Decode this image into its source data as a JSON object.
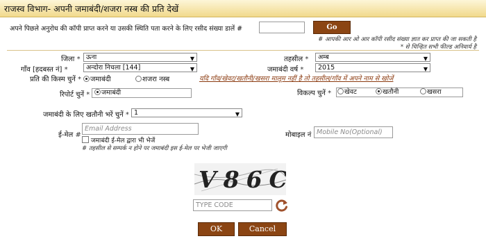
{
  "header": {
    "title": "राजस्व विभाग- अपनी जमाबंदी/शजरा नस्ब की प्रति देखें"
  },
  "receipt": {
    "label": "अपने पिछले अनुरोध की कॉपी प्राप्त करने या उसकी स्थिति पता करने के लिए रसीद संख्या डालें #",
    "value": "",
    "go_label": "Go",
    "note1": "# आपकी आर ओ आर कॉपी रसीद संख्या ज्ञात कर प्राप्त की जा सकती है",
    "note2": "* से चिन्हित सभी फील्ड अनिवार्य है"
  },
  "fields": {
    "district_label": "जिला",
    "district_value": "ऊना",
    "tehsil_label": "तहसील",
    "tehsil_value": "अम्ब",
    "village_label": "गाँव [हदबस्त नं]",
    "village_value": "अन्दोरा निचला [144]",
    "year_label": "जमाबंदी वर्ष",
    "year_value": "2015",
    "copytype_label": "प्रति की किस्म चुनें",
    "copytype_opt1": "जमाबंदी",
    "copytype_opt2": "शजरा नस्ब",
    "help_link": "यदि गाँव/खेवट/खतौनी/खसरा मालूम नहीं है तो तहसील/गाँव में अपने नाम से खोजें",
    "report_label": "रिपोर्ट चुनें",
    "report_value": "जमाबंदी",
    "option_label": "विकल्प चुनें",
    "option1": "खेवट",
    "option2": "खतौनी",
    "option3": "खसरा",
    "khatauni_label": "जमाबंदी के लिए खतौनी भरें चुनें",
    "khatauni_value": "1",
    "email_label": "ई-मेल",
    "email_placeholder": "Email Address",
    "email_checkbox": "जमाबंदी ई-मेल द्वारा भी भेजें",
    "email_note": "# तहसील से सम्पर्क न होने पर जमाबंदी इस ई-मेल पर भेजी जाएगी",
    "mobile_label": "मोबाइल नं",
    "mobile_placeholder": "Mobile No(Optional)"
  },
  "captcha": {
    "text": "V86C",
    "input_placeholder": "TYPE CODE",
    "refresh_icon": "refresh-icon"
  },
  "buttons": {
    "ok": "OK",
    "cancel": "Cancel"
  },
  "colors": {
    "button_brown": "#8b4513",
    "header_gold": "#f1d98c",
    "link_brown": "#8b3a0f"
  }
}
